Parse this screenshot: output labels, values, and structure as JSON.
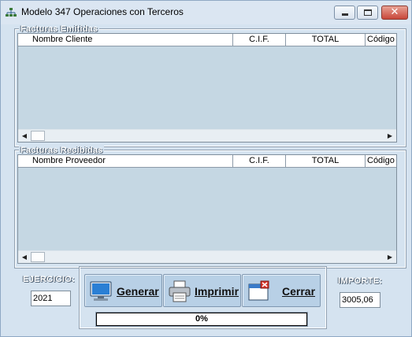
{
  "window": {
    "title": "Modelo 347 Operaciones con Terceros",
    "icon": "network-icon",
    "controls": {
      "minimize": "minimize-icon",
      "maximize": "maximize-icon",
      "close": "close-icon"
    }
  },
  "emitidas": {
    "title": "Facturas Emitidas",
    "columns": [
      "Nombre Cliente",
      "C.I.F.",
      "TOTAL",
      "Código"
    ],
    "rows": []
  },
  "recibidas": {
    "title": "Facturas Recibidas",
    "columns": [
      "Nombre Proveedor",
      "C.I.F.",
      "TOTAL",
      "Código"
    ],
    "rows": []
  },
  "ejercicio": {
    "label": "EJERCICIO:",
    "value": "2021"
  },
  "importe": {
    "label": "IMPORTE:",
    "value": "3005,06"
  },
  "buttons": {
    "generar": {
      "label": "Generar",
      "icon": "monitor-icon"
    },
    "imprimir": {
      "label": "Imprimir",
      "icon": "printer-icon"
    },
    "cerrar": {
      "label": "Cerrar",
      "icon": "window-close-icon"
    }
  },
  "progress": {
    "text": "0%",
    "value": 0
  },
  "colors": {
    "window_bg": "#d5e3f0",
    "grid_bg": "#c5d7e3",
    "button_bg": "#b8d0e6",
    "close_red": "#c8473a"
  }
}
